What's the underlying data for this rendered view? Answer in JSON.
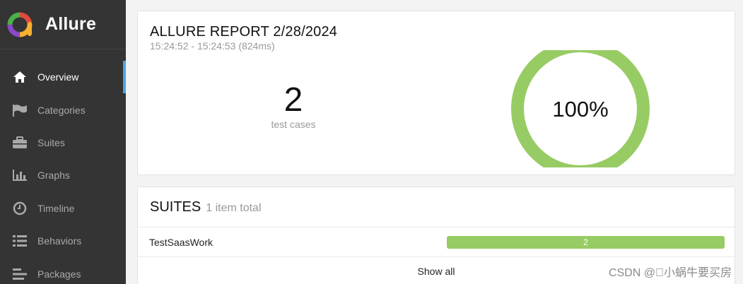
{
  "sidebar": {
    "brand": "Allure",
    "items": [
      {
        "label": "Overview",
        "icon": "home-icon",
        "active": true
      },
      {
        "label": "Categories",
        "icon": "flag-icon"
      },
      {
        "label": "Suites",
        "icon": "briefcase-icon"
      },
      {
        "label": "Graphs",
        "icon": "bar-chart-icon"
      },
      {
        "label": "Timeline",
        "icon": "clock-icon"
      },
      {
        "label": "Behaviors",
        "icon": "list-icon"
      },
      {
        "label": "Packages",
        "icon": "align-left-icon"
      }
    ]
  },
  "summary": {
    "title": "ALLURE REPORT 2/28/2024",
    "time": "15:24:52 - 15:24:53 (824ms)",
    "test_count": "2",
    "test_label": "test cases",
    "pass_rate": "100%",
    "pass_fraction": 1.0,
    "ring_color": "#97cc64"
  },
  "suites": {
    "title": "SUITES",
    "count_text": "1 item total",
    "rows": [
      {
        "name": "TestSaasWork",
        "passed": "2",
        "bar_color": "#97cc64"
      }
    ],
    "show_all": "Show all"
  },
  "watermark": "CSDN @\u0000小蜗牛要买房"
}
